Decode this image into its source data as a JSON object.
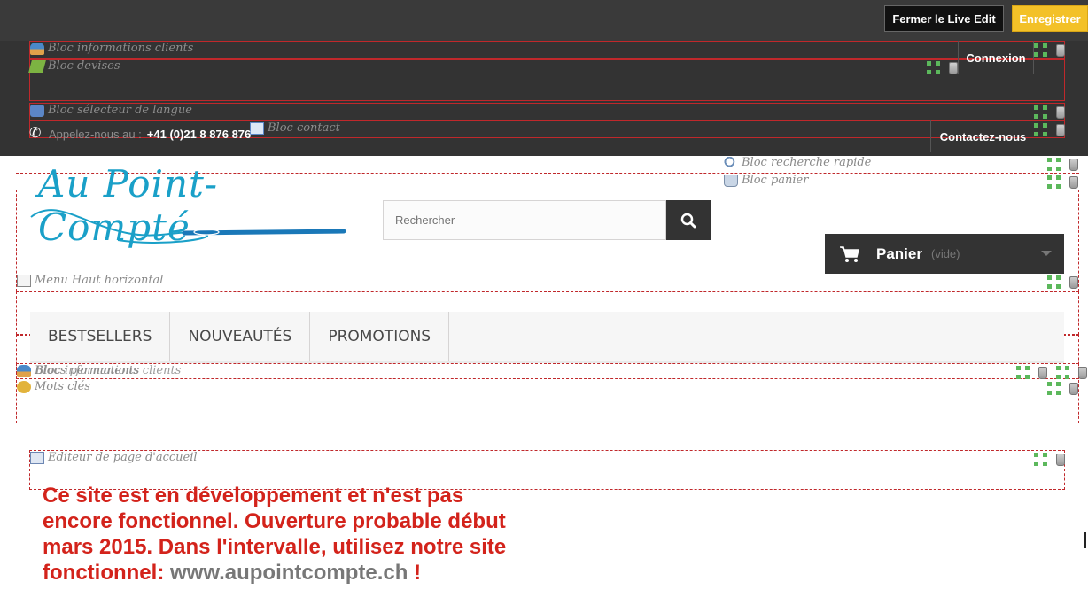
{
  "toolbar": {
    "close_label": "Fermer le Live Edit",
    "save_label": "Enregistrer"
  },
  "modules": {
    "customer_info": "Bloc informations clients",
    "currencies": "Bloc devises",
    "language": "Bloc sélecteur de langue",
    "contact": "Bloc contact",
    "search": "Bloc recherche rapide",
    "cart": "Bloc panier",
    "top_menu": "Menu Haut horizontal",
    "permanent_links": "Blocs permanents",
    "customer_info_2": "Bloc informations clients",
    "keywords": "Mots clés",
    "home_editor": "Editeur de page d'accueil"
  },
  "nav": {
    "login_label": "Connexion",
    "phone_prefix": "Appelez-nous au :",
    "phone_number": "+41 (0)21 8 876 876",
    "contact_label": "Contactez-nous"
  },
  "logo": {
    "text": "Au Point-Compté"
  },
  "search": {
    "placeholder": "Rechercher"
  },
  "cart": {
    "label": "Panier",
    "status": "(vide)"
  },
  "menu": {
    "items": [
      "BESTSELLERS",
      "NOUVEAUTÉS",
      "PROMOTIONS"
    ]
  },
  "notice": {
    "text": "Ce site est en développement et n'est pas encore fonctionnel. Ouverture probable début mars 2015. Dans l'intervalle, utilisez notre site fonctionnel: ",
    "link": "www.aupointcompte.ch",
    "suffix": " !"
  },
  "colors": {
    "toolbar_bg": "#3a3a3a",
    "save_button": "#f3c128",
    "outline": "#c0282b",
    "logo": "#1aa0c8",
    "notice": "#d3231b"
  }
}
